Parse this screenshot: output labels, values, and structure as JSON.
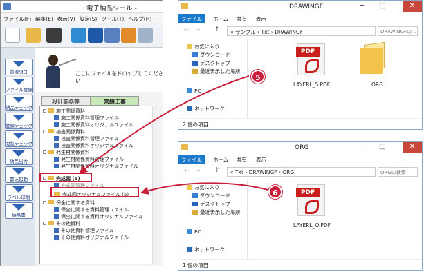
{
  "app": {
    "title": "電子納品ツール -",
    "menu": [
      "ファイル(F)",
      "編集(E)",
      "表示(V)",
      "設定(S)",
      "ツール(T)",
      "ヘルプ(H)"
    ],
    "side_buttons": [
      "管理項目",
      "ファイル登録",
      "納品チェック",
      "登録チェック",
      "閲覧チェック",
      "納品出力",
      "書込起動",
      "ラベル印刷",
      "納品書"
    ],
    "drop_message": "ここにファイルをドロップしてください",
    "tabs": [
      "設計業務等",
      "営繕工事"
    ],
    "tree": [
      "施工関係資料",
      "施工関係資料管理ファイル",
      "施工関係資料オリジナルファイル",
      "検査関係資料",
      "検査関係資料管理ファイル",
      "検査関係資料オリジナルファイル",
      "発生材関係資料",
      "発生材関係資料管理ファイル",
      "発生材関係資料オリジナルファイル",
      "完成図 (5)",
      "完成図管理ファイル",
      "完成図オリジナルファイル (5)",
      "保全に関する資料",
      "保全に関する資料管理ファイル",
      "保全に関する資料オリジナルファイル",
      "その他資料",
      "その他資料管理ファイル",
      "その他資料オリジナルファイル"
    ]
  },
  "win1": {
    "title": "DRAWINGF",
    "ribbon": [
      "ファイル",
      "ホーム",
      "共有",
      "表示"
    ],
    "address": "« サンプル › Txt › DRAWINGF",
    "search_placeholder": "DRAWINGFの...",
    "nav": [
      "お気に入り",
      "ダウンロード",
      "デスクトップ",
      "最近表示した場所",
      "PC",
      "ネットワーク"
    ],
    "files": [
      "LAYERL_S.PDF",
      "ORG"
    ],
    "pdf_label": "PDF",
    "status": "2 個の項目"
  },
  "win2": {
    "title": "ORG",
    "ribbon": [
      "ファイル",
      "ホーム",
      "共有",
      "表示"
    ],
    "address": "« Txt › DRAWINGF › ORG",
    "search_placeholder": "ORGの検索",
    "nav": [
      "お気に入り",
      "ダウンロード",
      "デスクトップ",
      "最近表示した場所",
      "PC",
      "ネットワーク"
    ],
    "files": [
      "LAYERL_O.PDF"
    ],
    "pdf_label": "PDF",
    "status": "1 個の項目"
  },
  "annotations": {
    "badge5": "5",
    "badge6": "6",
    "accent": "#c81e3a"
  }
}
